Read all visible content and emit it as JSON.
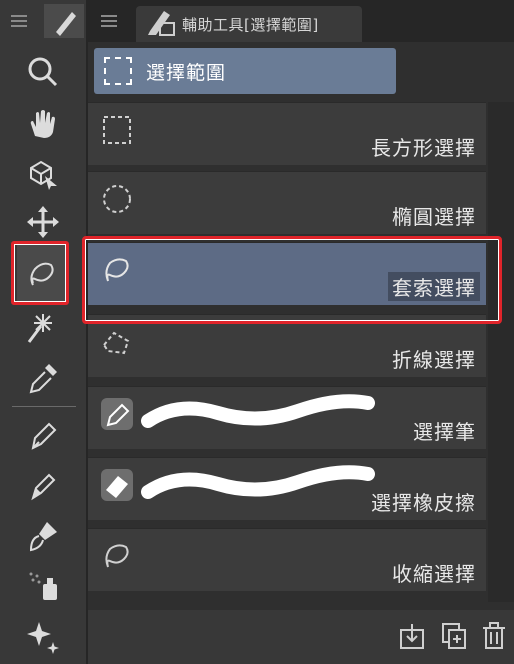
{
  "panel": {
    "tab_label": "輔助工具[選擇範圍]",
    "group_label": "選擇範圍"
  },
  "tools": [
    {
      "label": "長方形選擇",
      "icon": "rect-select-icon"
    },
    {
      "label": "橢圓選擇",
      "icon": "ellipse-select-icon"
    },
    {
      "label": "套索選擇",
      "icon": "lasso-select-icon",
      "selected": true
    },
    {
      "label": "折線選擇",
      "icon": "polyline-select-icon"
    },
    {
      "label": "選擇筆",
      "icon": "select-pen-icon"
    },
    {
      "label": "選擇橡皮擦",
      "icon": "select-eraser-icon"
    },
    {
      "label": "收縮選擇",
      "icon": "shrink-select-icon"
    }
  ],
  "toolbar_icons": [
    "zoom-icon",
    "hand-icon",
    "object-icon",
    "move-icon",
    "selection-icon",
    "auto-select-icon",
    "eyedropper-icon",
    "pen-icon",
    "pencil-icon",
    "brush-icon",
    "airbrush-icon",
    "decoration-icon"
  ],
  "colors": {
    "highlight": "#e0242a",
    "selected_row": "#5d6b85",
    "group_header": "#6a7c96"
  }
}
